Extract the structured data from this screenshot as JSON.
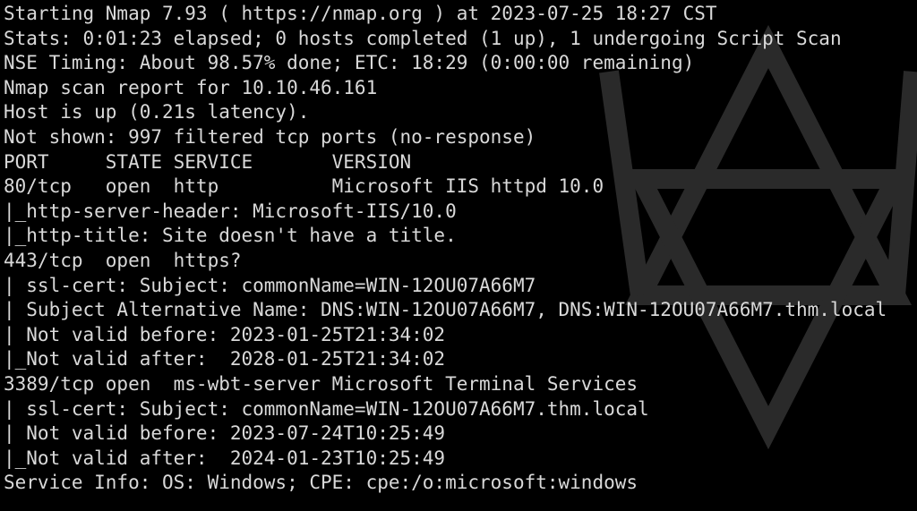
{
  "terminal": {
    "text_color": "#d9d9d9",
    "background_color": "#000000",
    "watermark_icon": "hexagram-outline-icon",
    "lines": [
      "Starting Nmap 7.93 ( https://nmap.org ) at 2023-07-25 18:27 CST",
      "Stats: 0:01:23 elapsed; 0 hosts completed (1 up), 1 undergoing Script Scan",
      "NSE Timing: About 98.57% done; ETC: 18:29 (0:00:00 remaining)",
      "Nmap scan report for 10.10.46.161",
      "Host is up (0.21s latency).",
      "Not shown: 997 filtered tcp ports (no-response)",
      "PORT     STATE SERVICE       VERSION",
      "80/tcp   open  http          Microsoft IIS httpd 10.0",
      "|_http-server-header: Microsoft-IIS/10.0",
      "|_http-title: Site doesn't have a title.",
      "443/tcp  open  https?",
      "| ssl-cert: Subject: commonName=WIN-12OU07A66M7",
      "| Subject Alternative Name: DNS:WIN-12OU07A66M7, DNS:WIN-12OU07A66M7.thm.local",
      "| Not valid before: 2023-01-25T21:34:02",
      "|_Not valid after:  2028-01-25T21:34:02",
      "3389/tcp open  ms-wbt-server Microsoft Terminal Services",
      "| ssl-cert: Subject: commonName=WIN-12OU07A66M7.thm.local",
      "| Not valid before: 2023-07-24T10:25:49",
      "|_Not valid after:  2024-01-23T10:25:49",
      "Service Info: OS: Windows; CPE: cpe:/o:microsoft:windows"
    ]
  }
}
